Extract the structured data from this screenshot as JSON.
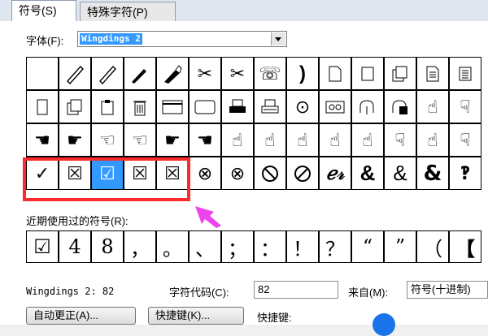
{
  "tabs": [
    {
      "label": "符号(S)"
    },
    {
      "label": "特殊字符(P)"
    }
  ],
  "font": {
    "label": "字体(F):",
    "value": "Wingdings 2"
  },
  "symbol_grid": {
    "rows": [
      [
        "",
        "pencil-icon",
        "pencil-icon",
        "fountain-pen-icon",
        "marker-pen-icon",
        "scissors-icon",
        "scissors-icon",
        "telephone-icon",
        "phone-handset-icon",
        "document-icon",
        "blank-page-icon",
        "pages-icon",
        "document-lines-icon",
        "document-lines-icon"
      ],
      [
        "blank-page-icon",
        "stacked-pages-icon",
        "clipboard-icon",
        "trash-can-icon",
        "window-icon",
        "rounded-rect-icon",
        "printer-icon",
        "printer-icon",
        "dot-circle-icon",
        "tape-icon",
        "hand-pointer-icon",
        "hand-pointer-icon",
        "hand-up-icon",
        "hand-down-icon"
      ],
      [
        "hand-left-icon",
        "hand-right-icon",
        "hand-left-icon",
        "hand-left-icon",
        "hand-right-icon",
        "hand-left-icon",
        "hand-up-icon",
        "hand-up-icon",
        "hand-up-icon",
        "hand-up-icon",
        "hand-up-icon",
        "hand-down-icon",
        "hand-up-icon",
        "hand-down-icon"
      ],
      [
        "✓",
        "☒",
        "☑",
        "☒",
        "☒",
        "⊗",
        "⊗",
        "⃠",
        "⃠",
        "ℯ𝓇",
        "&",
        "&",
        "&",
        "‽"
      ]
    ]
  },
  "recent": {
    "label": "近期使用过的符号(R):",
    "symbols": [
      "☑",
      "4",
      "8",
      "，",
      "。",
      "、",
      "；",
      "：",
      "！",
      "？",
      "“",
      "”",
      "（",
      "【"
    ]
  },
  "footer": {
    "font_code_text": "Wingdings 2: 82",
    "char_code_label": "字符代码(C):",
    "char_code_value": "82",
    "from_label": "来自(M):",
    "from_value": "符号(十进制)",
    "autocorrect_button": "自动更正(A)...",
    "shortcut_button": "快捷键(K)...",
    "shortcut_label": "快捷键:"
  },
  "colors": {
    "highlight": "#ff2b2b",
    "arrow": "#ee44ee",
    "selection": "#3399ff"
  }
}
